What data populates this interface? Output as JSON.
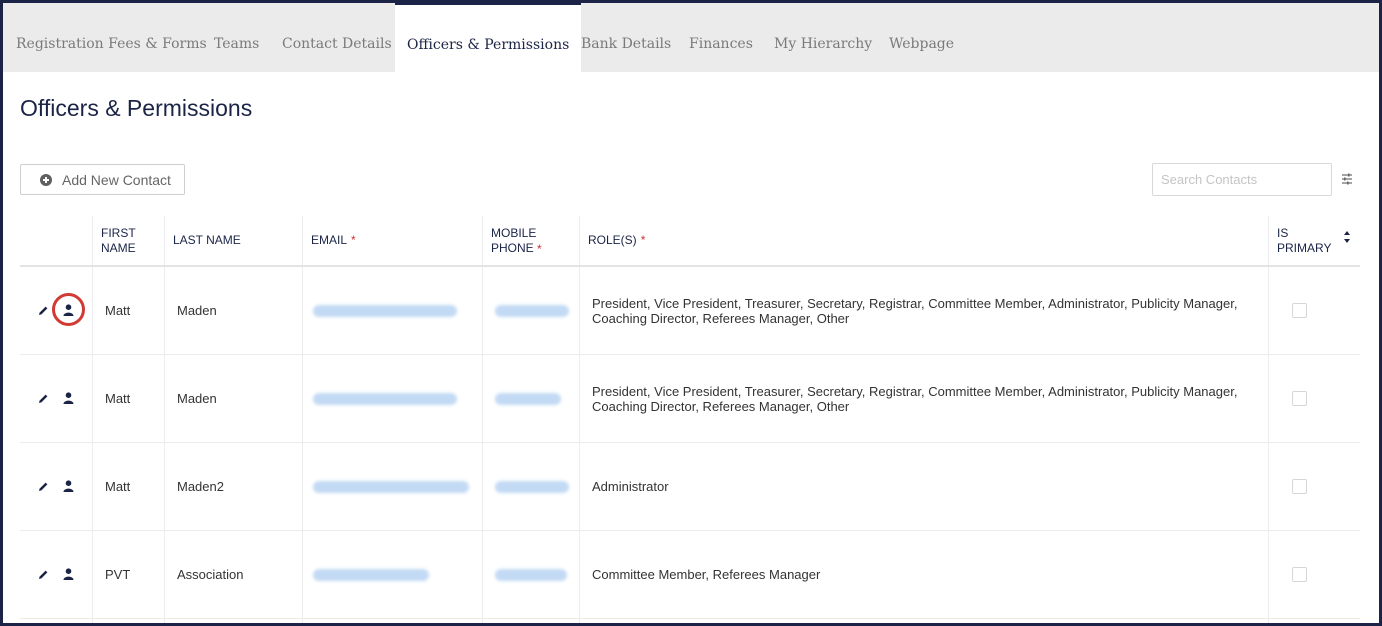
{
  "tabs": [
    {
      "label": "Registration Fees & Forms"
    },
    {
      "label": "Teams"
    },
    {
      "label": "Contact Details"
    },
    {
      "label": "Officers & Permissions"
    },
    {
      "label": "Bank Details"
    },
    {
      "label": "Finances"
    },
    {
      "label": "My Hierarchy"
    },
    {
      "label": "Webpage"
    }
  ],
  "page_title": "Officers & Permissions",
  "toolbar": {
    "add_label": "Add New Contact",
    "search_placeholder": "Search Contacts"
  },
  "columns": {
    "first_name": "FIRST NAME",
    "last_name": "LAST NAME",
    "email": "EMAIL",
    "mobile": "MOBILE PHONE",
    "roles": "ROLE(S)",
    "is_primary": "IS PRIMARY",
    "required_mark": "*"
  },
  "rows": [
    {
      "first": "Matt",
      "last": "Maden",
      "roles": "President, Vice President, Treasurer, Secretary, Registrar, Committee Member, Administrator, Publicity Manager, Coaching Director, Referees Manager, Other"
    },
    {
      "first": "Matt",
      "last": "Maden",
      "roles": "President, Vice President, Treasurer, Secretary, Registrar, Committee Member, Administrator, Publicity Manager, Coaching Director, Referees Manager, Other"
    },
    {
      "first": "Matt",
      "last": "Maden2",
      "roles": "Administrator"
    },
    {
      "first": "PVT",
      "last": "Association",
      "roles": "Committee Member, Referees Manager"
    }
  ],
  "colors": {
    "accent": "#1b2447",
    "required": "#d32f2f",
    "highlight": "#d23a34"
  }
}
